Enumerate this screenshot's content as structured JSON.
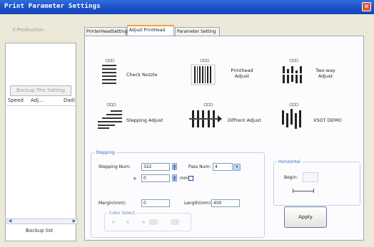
{
  "window": {
    "title": "Print Parameter Settings",
    "close_glyph": "✕"
  },
  "left_panel": {
    "mode_label": "X-Production",
    "backup_button": "Backup The Setting",
    "columns": [
      "Speed",
      "Adj...",
      "Dadi"
    ],
    "backup_list_label": "Backup list",
    "scroll_left_glyph": "◀",
    "scroll_right_glyph": "▶"
  },
  "tabs": [
    {
      "label": "PrinterHeadSetting",
      "active": false
    },
    {
      "label": "Adjust PrintHead",
      "active": true
    },
    {
      "label": "Parameter Setting",
      "active": false
    }
  ],
  "adjust_items": [
    {
      "label": "Check Nozzle",
      "icon": "check-nozzle-icon"
    },
    {
      "label": "Printhead Adjust",
      "icon": "printhead-adjust-icon"
    },
    {
      "label": "Two-way Adjust",
      "icon": "two-way-adjust-icon"
    },
    {
      "label": "Stepping Adjust",
      "icon": "stepping-adjust-icon"
    },
    {
      "label": "Diffrent Adjust",
      "icon": "different-adjust-icon"
    },
    {
      "label": "XSOT DEMO",
      "icon": "xsot-demo-icon"
    }
  ],
  "stepping": {
    "legend": "Stepping",
    "stepping_num_label": "Stepping Num:",
    "stepping_num_value": "322",
    "pass_num_label": "Pass Num:",
    "pass_num_value": "4",
    "offset_sign": "+",
    "offset_value": "0",
    "offset_unit": "mm",
    "margin_label": "Margin(mm):",
    "margin_value": "0",
    "length_label": "Length(mm):",
    "length_value": "400",
    "color_select_label": "Color Select"
  },
  "horizontal": {
    "legend": "Horizontal",
    "begin_label": "Begin:",
    "begin_value": ""
  },
  "apply_label": "Apply",
  "colors": {
    "titlebar": "#1a4fc6",
    "tab_accent": "#f1a33a",
    "legend_text": "#3a67c4"
  }
}
